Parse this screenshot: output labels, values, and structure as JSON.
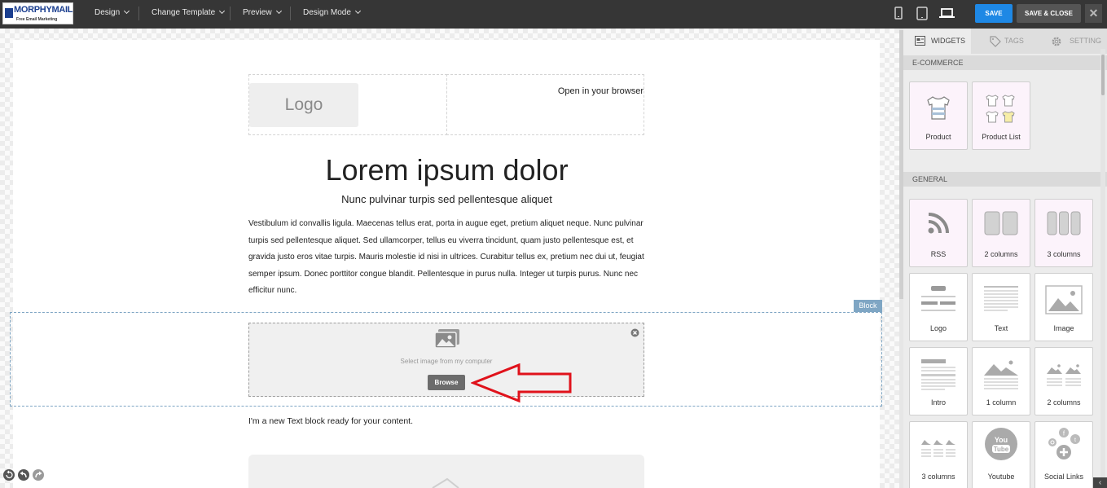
{
  "topbar": {
    "brand": "MORPHYMAIL",
    "brand_tagline": "Free Email Marketing",
    "menus": [
      {
        "label": "Design"
      },
      {
        "label": "Change Template"
      },
      {
        "label": "Preview"
      },
      {
        "label": "Design Mode"
      }
    ],
    "devices": [
      "mobile-icon",
      "tablet-icon",
      "desktop-icon"
    ],
    "save_label": "SAVE",
    "save_close_label": "SAVE & CLOSE",
    "close_label": "✕"
  },
  "canvas": {
    "logo_placeholder": "Logo",
    "open_in_browser": "Open in your browser",
    "headline": "Lorem ipsum dolor",
    "subheadline": "Nunc pulvinar turpis sed pellentesque aliquet",
    "paragraph": "Vestibulum id convallis ligula. Maecenas tellus erat, porta in augue eget, pretium aliquet neque. Nunc pulvinar turpis sed pellentesque aliquet. Sed ullamcorper, tellus eu viverra tincidunt, quam justo pellentesque est, et gravida justo eros vitae turpis. Mauris molestie id nisi in ultrices. Curabitur tellus ex, pretium nec dui ut, feugiat semper ipsum. Donec porttitor congue blandit. Pellentesque in purus nulla. Integer ut turpis purus. Nunc nec efficitur nunc.",
    "block_tag": "Block",
    "image_select_label": "Select image from my computer",
    "browse_label": "Browse",
    "new_text_block": "I'm a new Text block ready for your content."
  },
  "panel": {
    "tabs": [
      {
        "label": "WIDGETS",
        "icon": "widgets-icon",
        "active": true
      },
      {
        "label": "TAGS",
        "icon": "tag-icon",
        "active": false
      },
      {
        "label": "SETTING",
        "icon": "gear-icon",
        "active": false
      }
    ],
    "sections": [
      {
        "title": "E-COMMERCE",
        "items": [
          {
            "label": "Product",
            "icon": "shirt-icon"
          },
          {
            "label": "Product List",
            "icon": "shirt-list-icon"
          }
        ]
      },
      {
        "title": "GENERAL",
        "items": [
          {
            "label": "RSS",
            "icon": "rss-icon"
          },
          {
            "label": "2 columns",
            "icon": "two-columns-icon"
          },
          {
            "label": "3 columns",
            "icon": "three-columns-icon"
          },
          {
            "label": "Logo",
            "icon": "logo-icon"
          },
          {
            "label": "Text",
            "icon": "text-icon"
          },
          {
            "label": "Image",
            "icon": "image-icon"
          },
          {
            "label": "Intro",
            "icon": "intro-icon"
          },
          {
            "label": "1 column",
            "icon": "one-column-image-icon"
          },
          {
            "label": "2 columns",
            "icon": "two-column-images-icon"
          },
          {
            "label": "3 columns",
            "icon": "three-column-images-icon"
          },
          {
            "label": "Youtube",
            "icon": "youtube-icon"
          },
          {
            "label": "Social Links",
            "icon": "social-links-icon"
          }
        ]
      }
    ]
  },
  "colors": {
    "topbar": "#363636",
    "save_button": "#1e88e5",
    "block_outline": "#7fa6c4",
    "arrow": "#e0121b"
  }
}
